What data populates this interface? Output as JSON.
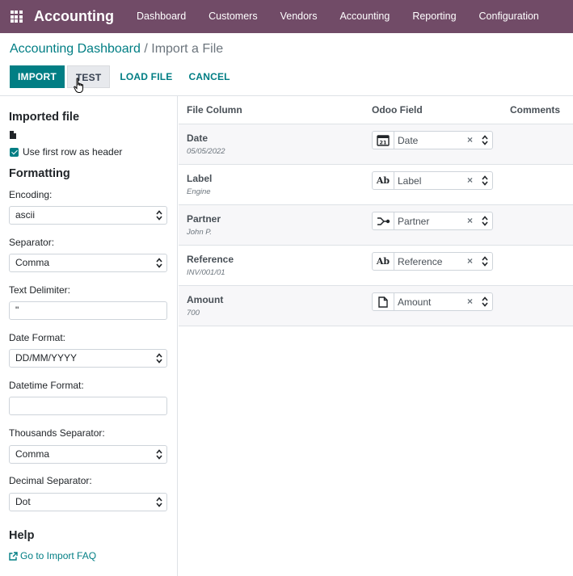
{
  "nav": {
    "app_name": "Accounting",
    "items": [
      "Dashboard",
      "Customers",
      "Vendors",
      "Accounting",
      "Reporting",
      "Configuration"
    ]
  },
  "breadcrumb": {
    "parent": "Accounting Dashboard",
    "separator": "/",
    "current": "Import a File"
  },
  "toolbar": {
    "import": "IMPORT",
    "test": "TEST",
    "load_file": "LOAD FILE",
    "cancel": "CANCEL"
  },
  "sidebar": {
    "imported_file_title": "Imported file",
    "use_header_label": "Use first row as header",
    "formatting_title": "Formatting",
    "encoding": {
      "label": "Encoding:",
      "value": "ascii"
    },
    "separator": {
      "label": "Separator:",
      "value": "Comma"
    },
    "text_delimiter": {
      "label": "Text Delimiter:",
      "value": "\""
    },
    "date_format": {
      "label": "Date Format:",
      "value": "DD/MM/YYYY"
    },
    "datetime_format": {
      "label": "Datetime Format:",
      "value": ""
    },
    "thousands_separator": {
      "label": "Thousands Separator:",
      "value": "Comma"
    },
    "decimal_separator": {
      "label": "Decimal Separator:",
      "value": "Dot"
    },
    "help_title": "Help",
    "help_link": "Go to Import FAQ"
  },
  "table": {
    "headers": {
      "file_column": "File Column",
      "odoo_field": "Odoo Field",
      "comments": "Comments"
    },
    "rows": [
      {
        "name": "Date",
        "sample": "05/05/2022",
        "field": "Date",
        "icon": "calendar-icon",
        "icon_text": "21"
      },
      {
        "name": "Label",
        "sample": "Engine",
        "field": "Label",
        "icon": "text-icon",
        "icon_text": "Ab"
      },
      {
        "name": "Partner",
        "sample": "John P.",
        "field": "Partner",
        "icon": "relation-icon",
        "icon_text": ""
      },
      {
        "name": "Reference",
        "sample": "INV/001/01",
        "field": "Reference",
        "icon": "text-icon",
        "icon_text": "Ab"
      },
      {
        "name": "Amount",
        "sample": "700",
        "field": "Amount",
        "icon": "document-icon",
        "icon_text": ""
      }
    ]
  },
  "colors": {
    "navbar": "#714b67",
    "primary": "#017e84"
  }
}
